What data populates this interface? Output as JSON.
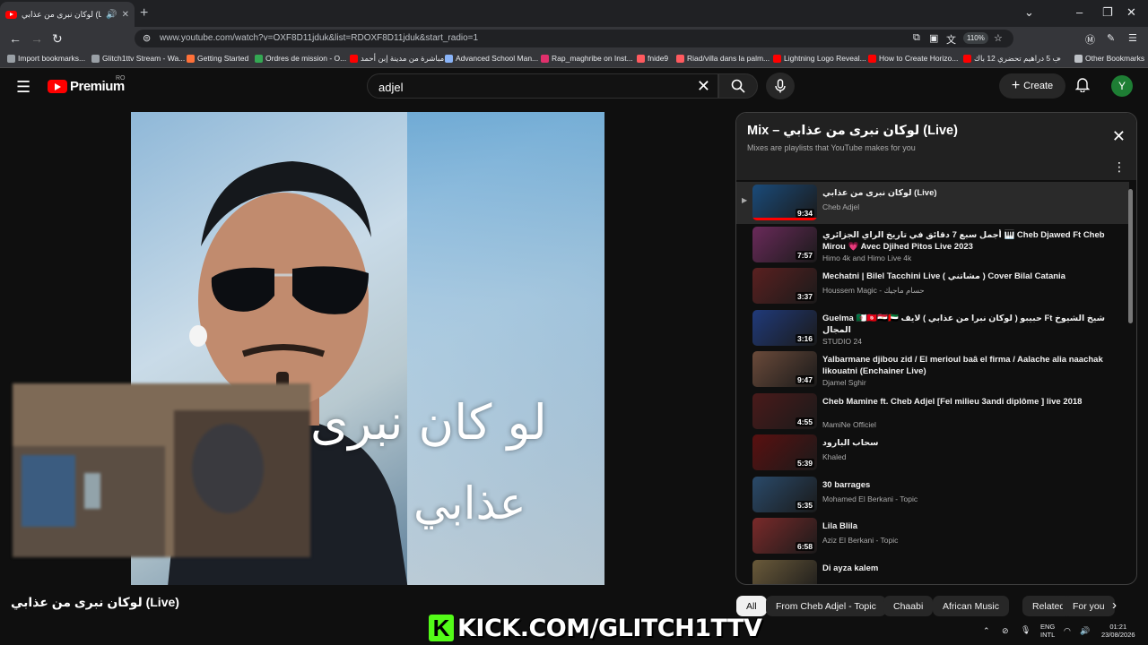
{
  "browser": {
    "tab_title": "لوكان نبرى من عذابي (Live)",
    "new_tab_glyph": "+",
    "url": "www.youtube.com/watch?v=OXF8D11jduk&list=RDOXF8D11jduk&start_radio=1",
    "zoom": "110%",
    "bookmarks": [
      {
        "label": "Import bookmarks...",
        "color": "#9aa0a6"
      },
      {
        "label": "Glitch1ttv Stream - Wa...",
        "color": "#9aa0a6"
      },
      {
        "label": "Getting Started",
        "color": "#ff7139"
      },
      {
        "label": "Ordres de mission - O...",
        "color": "#34a853"
      },
      {
        "label": "مباشرة من مدينة إبن أحمد",
        "color": "#ff0000"
      },
      {
        "label": "Advanced School Man...",
        "color": "#8ab4f8"
      },
      {
        "label": "Rap_maghribe on Inst...",
        "color": "#e1306c"
      },
      {
        "label": "fnide9",
        "color": "#ff5a5f"
      },
      {
        "label": "Riad/villa dans la palm...",
        "color": "#ff5a5f"
      },
      {
        "label": "Lightning Logo Reveal...",
        "color": "#ff0000"
      },
      {
        "label": "How to Create Horizo...",
        "color": "#ff0000"
      },
      {
        "label": "ب 5 دراهيم تحضري 12 باك",
        "color": "#ff0000"
      }
    ],
    "other_bookmarks": "Other Bookmarks"
  },
  "header": {
    "logo_text": "Premium",
    "region": "RO",
    "search_value": "adjel",
    "create_label": "Create",
    "avatar_letter": "Y"
  },
  "video": {
    "overlay_line1": "لو كان نبرى",
    "overlay_line2": "عذابي",
    "title": "لوكان نبرى من عذابي (Live)"
  },
  "mix": {
    "title": "Mix – لوكان نبرى من عذابي (Live)",
    "subtitle": "Mixes are playlists that YouTube makes for you",
    "items": [
      {
        "title": "لوكان نبرى من عذابي (Live)",
        "channel": "Cheb Adjel",
        "duration": "9:34",
        "thumb": "#1a4b7a",
        "progress": 1.0,
        "active": true
      },
      {
        "title": "أجمل سبع 7 دقائق في تاريخ الراي الجزائري 🎹 Cheb Djawed Ft Cheb Mirou 💗 Avec Djihed Pitos Live 2023",
        "channel": "Himo 4k and Himo Live 4k",
        "duration": "7:57",
        "thumb": "#6a2a5a",
        "progress": 0.0,
        "active": false
      },
      {
        "title": "Mechatni | Bilel Tacchini Live ( مشاتني ) Cover Bilal Catania",
        "channel": "Houssem Magic - حسام ماجيك",
        "duration": "3:37",
        "thumb": "#5a2020",
        "progress": 0.0,
        "active": false
      },
      {
        "title": "Guelma 🇩🇿🇹🇳🇪🇬🇦🇪 حبيبو ( لوكان نبرا من عذابي ) لايف Ft شيخ الشيوخ المجال",
        "channel": "STUDIO 24",
        "duration": "3:16",
        "thumb": "#203a7a",
        "progress": 0.0,
        "active": false
      },
      {
        "title": "Yalbarmane djibou zid / El merioul baâ el firma / Aalache alia naachak likouatni (Enchainer Live)",
        "channel": "Djamel Sghir",
        "duration": "9:47",
        "thumb": "#6a4a3a",
        "progress": 0.0,
        "active": false
      },
      {
        "title": "Cheb Mamine ft. Cheb Adjel [Fel milieu 3andi diplôme ] live 2018",
        "channel": "MamiNe Officiel",
        "duration": "4:55",
        "thumb": "#4a1a1a",
        "progress": 0.0,
        "active": false
      },
      {
        "title": "سحاب البارود",
        "channel": "Khaled",
        "duration": "5:39",
        "thumb": "#5a1010",
        "progress": 0.0,
        "active": false
      },
      {
        "title": "30 barrages",
        "channel": "Mohamed El Berkani - Topic",
        "duration": "5:35",
        "thumb": "#2a4a6a",
        "progress": 0.0,
        "active": false
      },
      {
        "title": "Lila Blila",
        "channel": "Aziz El Berkani - Topic",
        "duration": "6:58",
        "thumb": "#7a2a2a",
        "progress": 0.0,
        "active": false
      },
      {
        "title": "Di ayza kalem",
        "channel": "",
        "duration": "",
        "thumb": "#6a5a3a",
        "progress": 0.0,
        "active": false
      }
    ]
  },
  "chips": [
    "All",
    "From Cheb Adjel - Topic",
    "Chaabi",
    "African Music",
    "Related",
    "For you"
  ],
  "overlay": {
    "kick_logo": "K",
    "kick_text": "KICK.COM/GLITCH1TTV"
  },
  "taskbar": {
    "lang_line1": "ENG",
    "lang_line2": "INTL",
    "time": "01:21",
    "date": "23/08/2026"
  }
}
